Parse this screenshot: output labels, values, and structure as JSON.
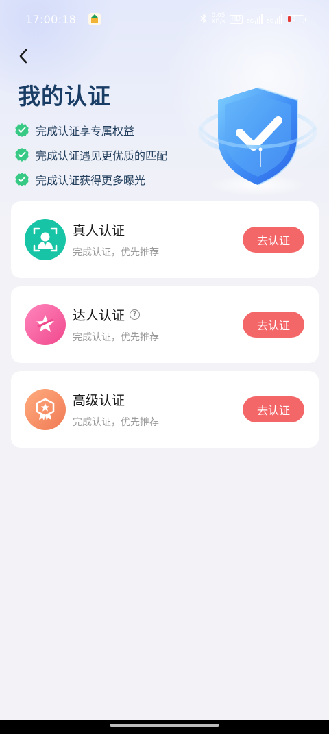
{
  "status_bar": {
    "time": "17:00:18",
    "network_speed_top": "0.05",
    "network_speed_unit": "KB/s",
    "hd_badge": "HD",
    "signal_1": "5G",
    "signal_2": "5G",
    "battery_level": "6",
    "icons": [
      "app-store-icon",
      "bluetooth-icon",
      "signal-icon",
      "battery-icon"
    ]
  },
  "header": {
    "back_icon": "chevron-left-icon",
    "title": "我的认证"
  },
  "benefits": [
    {
      "icon": "check-badge-icon",
      "text": "完成认证享专属权益"
    },
    {
      "icon": "check-badge-icon",
      "text": "完成认证遇见更优质的匹配"
    },
    {
      "icon": "check-badge-icon",
      "text": "完成认证获得更多曝光"
    }
  ],
  "hero_art": {
    "icon": "shield-check-icon"
  },
  "cards": [
    {
      "icon": "person-verify-icon",
      "icon_color": "#17c4a6",
      "title": "真人认证",
      "subtitle": "完成认证，优先推荐",
      "button": "去认证",
      "has_help": false
    },
    {
      "icon": "star-icon",
      "icon_color": "#f2589b",
      "title": "达人认证",
      "subtitle": "完成认证，优先推荐",
      "button": "去认证",
      "has_help": true,
      "help_icon": "question-circle-icon"
    },
    {
      "icon": "medal-icon",
      "icon_color": "#f5875d",
      "title": "高级认证",
      "subtitle": "完成认证，优先推荐",
      "button": "去认证",
      "has_help": false
    }
  ],
  "colors": {
    "accent_button": "#f46769",
    "title": "#1a3d66",
    "check": "#38c984",
    "background": "#f2f2f7"
  }
}
